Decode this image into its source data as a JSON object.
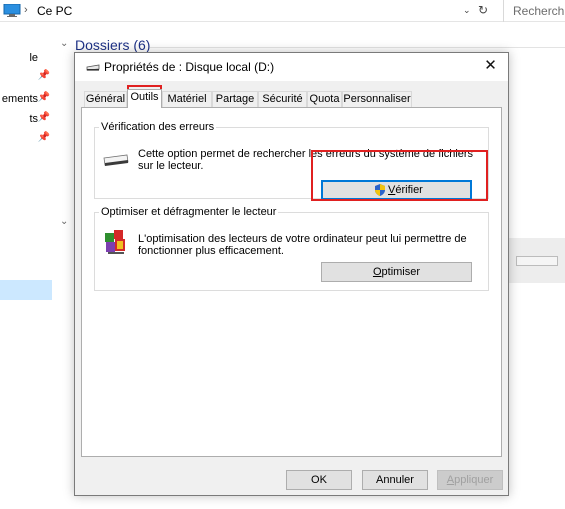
{
  "explorer": {
    "breadcrumb_sep": "›",
    "location": "Ce PC",
    "dropdown_glyph": "⌄",
    "refresh_glyph": "↻",
    "search_placeholder": "Recherch",
    "nav_items": [
      {
        "label": "le",
        "pinned": false
      },
      {
        "label": "",
        "pinned": true
      },
      {
        "label": "ements",
        "pinned": true
      },
      {
        "label": "ts",
        "pinned": true
      },
      {
        "label": "",
        "pinned": true
      }
    ],
    "pin_glyph": "📌",
    "group_header": "Dossiers (6)",
    "group_chevron": "⌄",
    "second_chevron": "⌄"
  },
  "dialog": {
    "title": "Propriétés de : Disque local (D:)",
    "close_glyph": "✕",
    "tabs": [
      "Général",
      "Outils",
      "Matériel",
      "Partage",
      "Sécurité",
      "Quota",
      "Personnaliser"
    ],
    "active_tab": "Outils",
    "error_check": {
      "legend": "Vérification des erreurs",
      "description": "Cette option permet de rechercher les erreurs du système de fichiers sur le lecteur.",
      "button_label": "Vérifier",
      "button_underline": "V",
      "button_rest": "érifier"
    },
    "optimize": {
      "legend": "Optimiser et défragmenter le lecteur",
      "description": "L'optimisation des lecteurs de votre ordinateur peut lui permettre de fonctionner plus efficacement.",
      "button_label": "Optimiser",
      "button_underline": "O",
      "button_rest": "ptimiser"
    },
    "footer": {
      "ok": "OK",
      "cancel": "Annuler",
      "apply": "Appliquer",
      "apply_underline": "A",
      "apply_rest": "ppliquer"
    }
  },
  "colors": {
    "annotation": "#e02020",
    "focus": "#0078d7",
    "link_header": "#1e3287",
    "dialog_bg": "#f0f0f0"
  }
}
